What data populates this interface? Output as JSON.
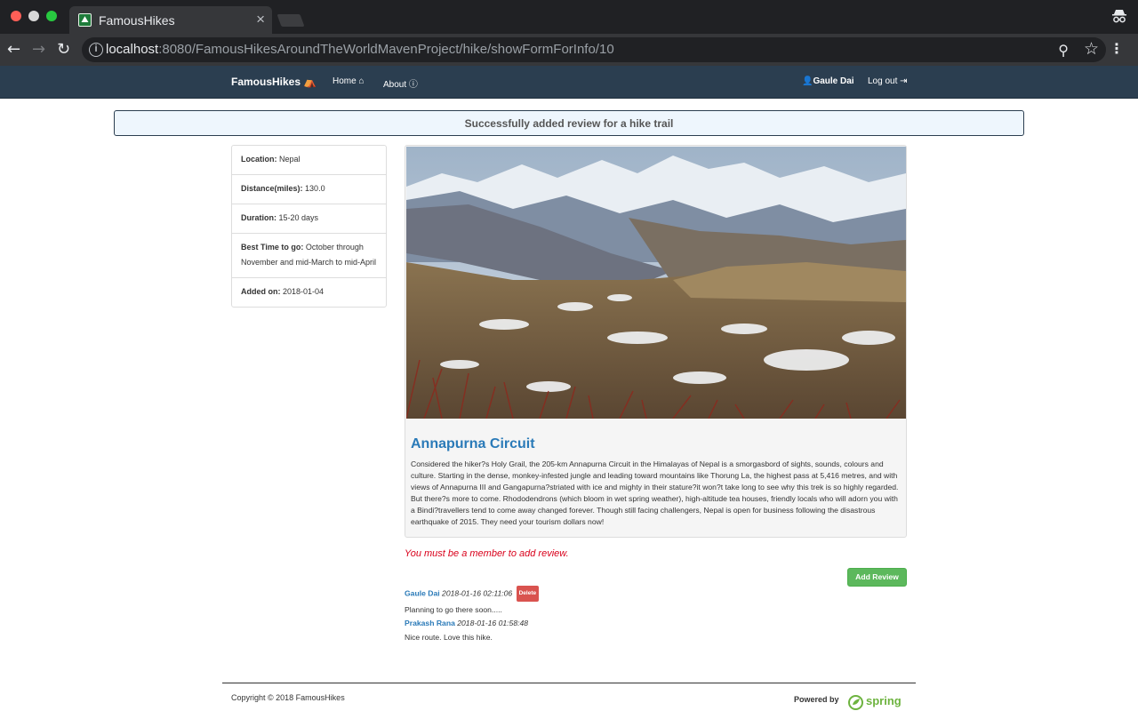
{
  "browser": {
    "tab_title": "FamousHikes",
    "tab_close": "×",
    "url_host": "localhost",
    "url_rest": ":8080/FamousHikesAroundTheWorldMavenProject/hike/showFormForInfo/10",
    "icons": [
      "back-arrow-icon",
      "forward-arrow-icon",
      "reload-icon",
      "info-icon",
      "zoom-icon",
      "bookmark-star-icon",
      "menu-icon",
      "incognito-icon"
    ]
  },
  "navbar": {
    "brand": "FamousHikes",
    "home": "Home",
    "about": "About",
    "user": "Gaule Dai",
    "logout": "Log out",
    "background": "#2b3e50"
  },
  "alert": {
    "message": "Successfully added review for a hike trail"
  },
  "info": {
    "location_label": "Location:",
    "location_value": "Nepal",
    "distance_label": "Distance(miles):",
    "distance_value": "130.0",
    "duration_label": "Duration:",
    "duration_value": "15-20 days",
    "besttime_label": "Best Time to go:",
    "besttime_value": "October through November and mid-March to mid-April",
    "added_label": "Added on:",
    "added_value": "2018-01-04"
  },
  "hike": {
    "title": "Annapurna Circuit",
    "description": "Considered the hiker?s Holy Grail, the 205-km Annapurna Circuit in the Himalayas of Nepal is a smorgasbord of sights, sounds, colours and culture. Starting in the dense, monkey-infested jungle and leading toward mountains like Thorung La, the highest pass at 5,416 metres, and with views of Annapurna III and Gangapurna?striated with ice and mighty in their stature?it won?t take long to see why this trek is so highly regarded. But there?s more to come. Rhododendrons (which bloom in wet spring weather), high-altitude tea houses, friendly locals who will adorn you with a Bindi?travellers tend to come away changed forever. Though still facing challengers, Nepal is open for business following the disastrous earthquake of 2015. They need your tourism dollars now!"
  },
  "reviews_section": {
    "member_note": "You must be a member to add review.",
    "add_review": "Add Review",
    "delete_label": "Delete"
  },
  "reviews": [
    {
      "author": "Gaule Dai",
      "date": "2018-01-16 02:11:06",
      "text": "Planning to go there soon.....",
      "deletable": true
    },
    {
      "author": "Prakash Rana",
      "date": "2018-01-16 01:58:48",
      "text": "Nice route. Love this hike.",
      "deletable": false
    }
  ],
  "footer": {
    "copyright": "Copyright © 2018 FamousHikes",
    "powered_by": "Powered by",
    "spring": "spring",
    "spring_color": "#6db33f"
  }
}
